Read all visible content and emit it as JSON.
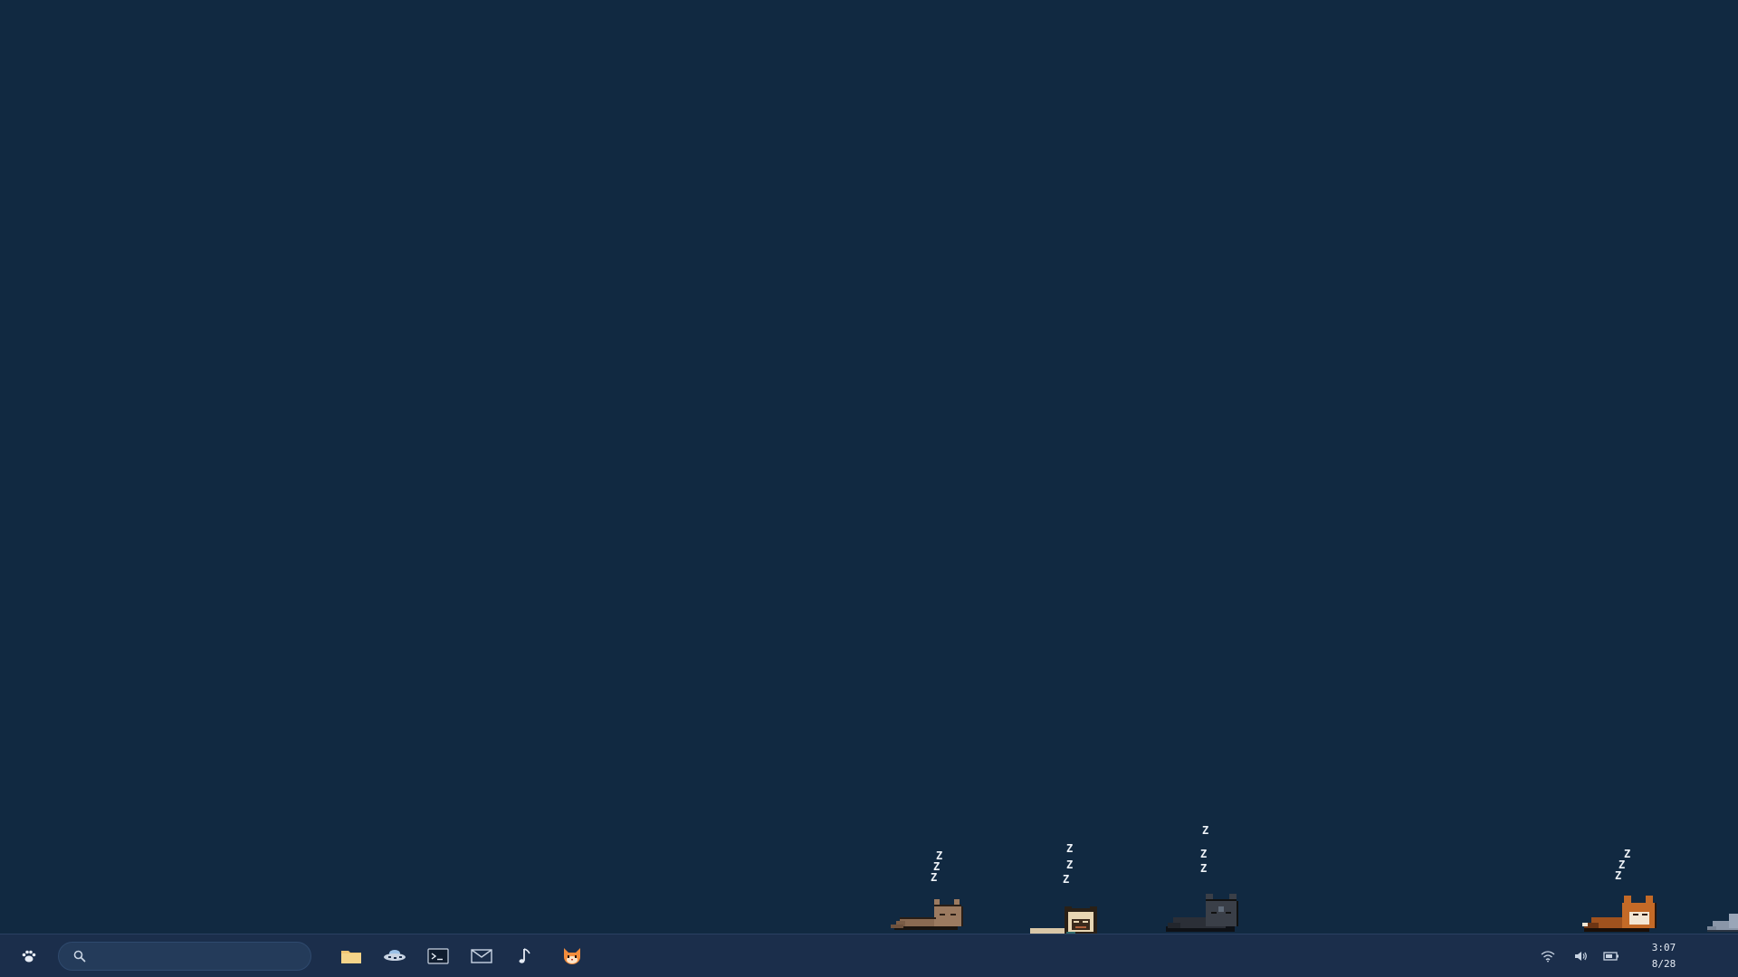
{
  "desktop": {
    "background_color": "#112941",
    "pets": [
      {
        "name": "brown-cat",
        "state": "sleeping",
        "zzz": [
          "Z",
          "Z",
          "Z"
        ]
      },
      {
        "name": "pug",
        "state": "sleeping",
        "zzz": [
          "Z",
          "Z",
          "Z"
        ]
      },
      {
        "name": "black-cat",
        "state": "sleeping",
        "zzz": [
          "Z",
          "Z",
          "Z"
        ]
      },
      {
        "name": "orange-fox-cat",
        "state": "sleeping",
        "zzz": [
          "Z",
          "Z",
          "Z"
        ]
      },
      {
        "name": "grey-cat",
        "state": "partially-visible"
      }
    ]
  },
  "taskbar": {
    "background_color": "#1b2e4b",
    "start_icon": "paw-icon",
    "search": {
      "value": "",
      "placeholder": "",
      "icon": "search-icon"
    },
    "pinned_apps": [
      {
        "name": "files",
        "icon": "folder-icon"
      },
      {
        "name": "browser",
        "icon": "ufo-icon"
      },
      {
        "name": "terminal",
        "icon": "terminal-icon"
      },
      {
        "name": "mail",
        "icon": "mail-icon"
      },
      {
        "name": "music",
        "icon": "music-note-icon"
      },
      {
        "name": "pets",
        "icon": "cat-face-icon"
      }
    ],
    "tray": [
      {
        "name": "network",
        "icon": "wifi-icon"
      },
      {
        "name": "volume",
        "icon": "speaker-icon"
      },
      {
        "name": "battery",
        "icon": "battery-icon"
      }
    ],
    "clock": {
      "time": "3:07",
      "date": "8/28"
    }
  }
}
